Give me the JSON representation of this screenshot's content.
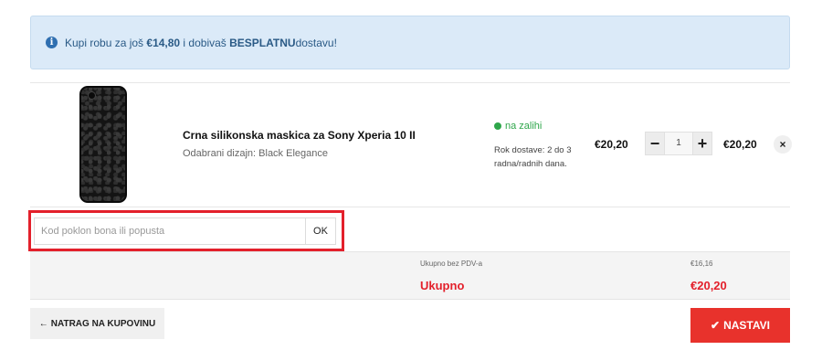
{
  "notice": {
    "icon": "info-icon",
    "prefix": "Kupi robu za još ",
    "amount": "€14,80",
    "middle": " i dobivaš ",
    "highlight": "BESPLATNU",
    "suffix": "dostavu!"
  },
  "cart_item": {
    "name": "Crna silikonska maskica za Sony Xperia 10 II",
    "variant": "Odabrani dizajn: Black Elegance",
    "stock": "na zalihi",
    "delivery": "Rok dostave: 2 do 3 radna/radnih dana.",
    "price": "€20,20",
    "quantity": "1",
    "total": "€20,20",
    "minus_label": "−",
    "plus_label": "+",
    "remove_label": "×"
  },
  "coupon": {
    "placeholder": "Kod poklon bona ili popusta",
    "value": "",
    "button_label": "OK"
  },
  "summary": {
    "subtotal_label": "Ukupno bez PDV-a",
    "subtotal_value": "€16,16",
    "total_label": "Ukupno",
    "total_value": "€20,20"
  },
  "actions": {
    "back_icon": "arrow-left-icon",
    "back_label": "NATRAG NA KUPOVINU",
    "next_icon": "checkmark-icon",
    "next_label": "NASTAVI"
  },
  "colors": {
    "accent_red": "#e3202b",
    "button_red": "#e8322c",
    "notice_bg": "#dbeaf8",
    "stock_green": "#2ea64a"
  }
}
